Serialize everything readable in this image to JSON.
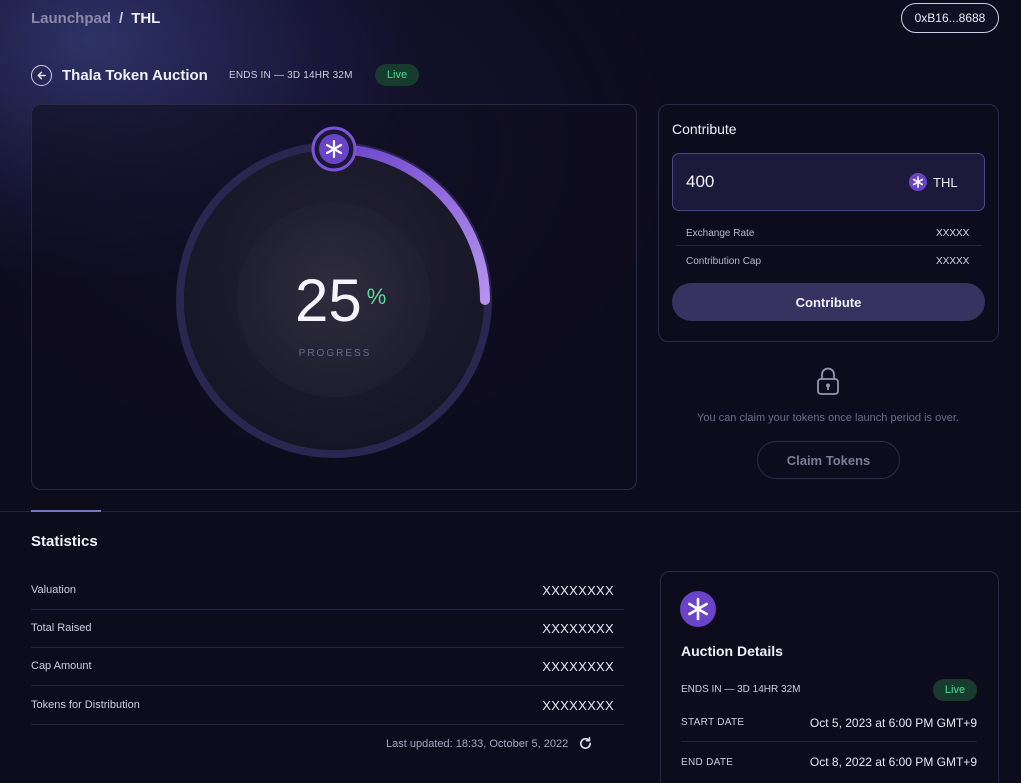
{
  "breadcrumb": {
    "parent": "Launchpad",
    "separator": "/",
    "current": "THL"
  },
  "wallet": {
    "address": "0xB16...8688"
  },
  "header": {
    "title": "Thala Token Auction",
    "ends_in": "ENDS IN — 3D 14HR 32M",
    "status": "Live"
  },
  "progress": {
    "value": "25",
    "unit": "%",
    "label": "PROGRESS",
    "fraction": 0.25
  },
  "contribute": {
    "title": "Contribute",
    "amount": "400",
    "token": "THL",
    "exchange_rate_label": "Exchange Rate",
    "exchange_rate_value": "XXXXX",
    "cap_label": "Contribution Cap",
    "cap_value": "XXXXX",
    "button": "Contribute"
  },
  "claim": {
    "message": "You can claim your tokens once launch period is over.",
    "button": "Claim Tokens"
  },
  "statistics": {
    "title": "Statistics",
    "rows": [
      {
        "label": "Valuation",
        "value": "XXXXXXXX"
      },
      {
        "label": "Total Raised",
        "value": "XXXXXXXX"
      },
      {
        "label": "Cap Amount",
        "value": "XXXXXXXX"
      },
      {
        "label": "Tokens for Distribution",
        "value": "XXXXXXXX"
      }
    ],
    "last_updated": "Last updated: 18:33, October 5, 2022"
  },
  "auction": {
    "title": "Auction Details",
    "ends_in": "ENDS IN — 3D 14HR 32M",
    "status": "Live",
    "start_label": "START DATE",
    "start_value": "Oct 5, 2023 at 6:00 PM GMT+9",
    "end_label": "END DATE",
    "end_value": "Oct 8, 2022 at 6:00 PM GMT+9"
  },
  "colors": {
    "accent": "#8f6ee0",
    "live_green": "#53d99a",
    "button_bg": "#37325f",
    "background": "#0d0c1c"
  },
  "icons": {
    "back": "arrow-left-icon",
    "token": "thala-asterisk-icon",
    "lock": "lock-icon",
    "refresh": "refresh-icon"
  }
}
